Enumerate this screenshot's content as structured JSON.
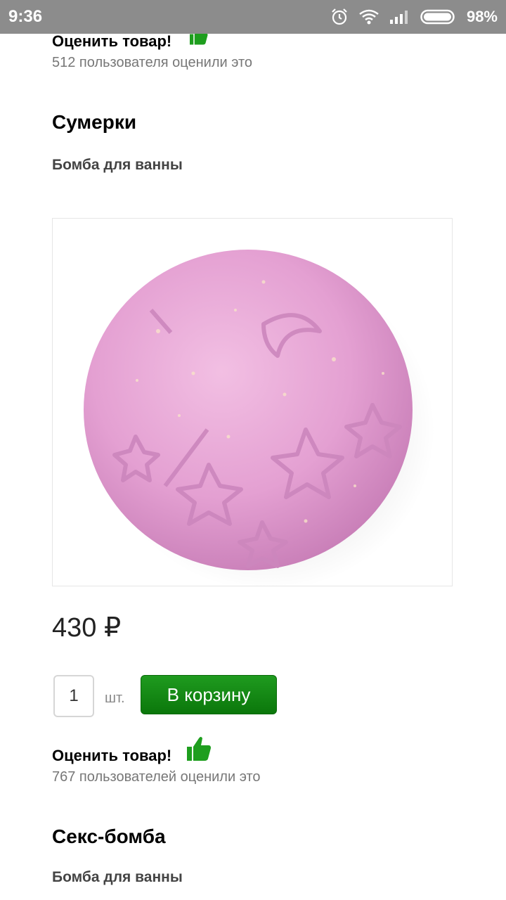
{
  "status_bar": {
    "time": "9:36",
    "battery_percent": "98%"
  },
  "products": [
    {
      "rating_label": "Оценить товар!",
      "rating_count": "512 пользователя оценили это"
    },
    {
      "title": "Сумерки",
      "subtitle": "Бомба для ванны",
      "image_alt": "pink bath bomb",
      "price": "430 ₽",
      "quantity": "1",
      "quantity_unit": "шт.",
      "add_to_cart_label": "В корзину",
      "rating_label": "Оценить товар!",
      "rating_count": "767 пользователей оценили это"
    },
    {
      "title": "Секс-бомба",
      "subtitle": "Бомба для ванны"
    }
  ],
  "colors": {
    "status_bar_bg": "#8c8c8c",
    "cart_button": "#139013",
    "thumb_icon": "#1e9e1e",
    "bath_bomb": "#e5a3d2"
  },
  "icons": [
    "alarm-icon",
    "wifi-icon",
    "signal-icon",
    "battery-icon",
    "thumbs-up-icon"
  ]
}
